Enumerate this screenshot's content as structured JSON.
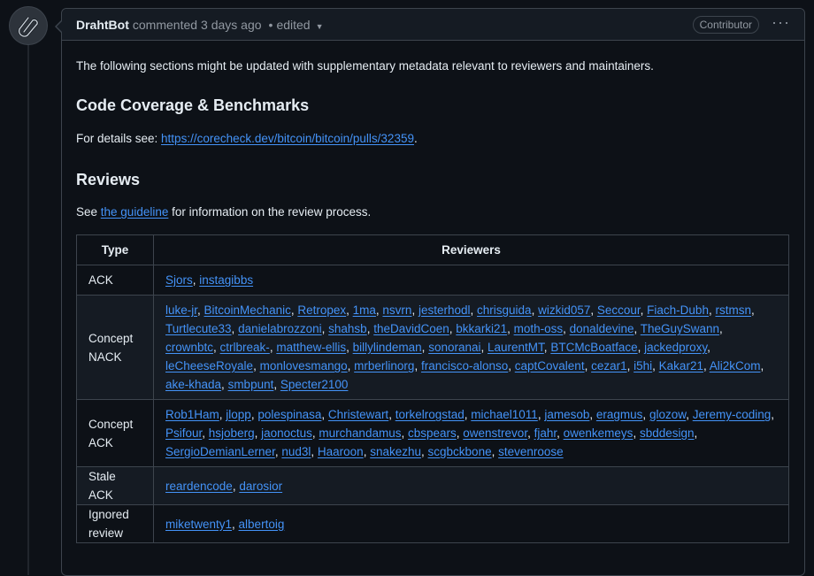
{
  "comment": {
    "author": "DrahtBot",
    "action": "commented",
    "time": "3 days ago",
    "separator": "•",
    "edited": "edited",
    "badge": "Contributor",
    "menu": "···"
  },
  "body": {
    "intro": "The following sections might be updated with supplementary metadata relevant to reviewers and maintainers.",
    "coverage_heading": "Code Coverage & Benchmarks",
    "details_prefix": "For details see: ",
    "details_link": "https://corecheck.dev/bitcoin/bitcoin/pulls/32359",
    "details_suffix": ".",
    "reviews_heading": "Reviews",
    "see_prefix": "See ",
    "guideline_link": "the guideline",
    "see_suffix": " for information on the review process."
  },
  "table": {
    "headers": [
      "Type",
      "Reviewers"
    ],
    "rows": [
      {
        "type": "ACK",
        "reviewers": [
          "Sjors",
          "instagibbs"
        ]
      },
      {
        "type": "Concept NACK",
        "reviewers": [
          "luke-jr",
          "BitcoinMechanic",
          "Retropex",
          "1ma",
          "nsvrn",
          "jesterhodl",
          "chrisguida",
          "wizkid057",
          "Seccour",
          "Fiach-Dubh",
          "rstmsn",
          "Turtlecute33",
          "danielabrozzoni",
          "shahsb",
          "theDavidCoen",
          "bkkarki21",
          "moth-oss",
          "donaldevine",
          "TheGuySwann",
          "crownbtc",
          "ctrlbreak-",
          "matthew-ellis",
          "billylindeman",
          "sonoranai",
          "LaurentMT",
          "BTCMcBoatface",
          "jackedproxy",
          "leCheeseRoyale",
          "monlovesmango",
          "mrberlinorg",
          "francisco-alonso",
          "captCovalent",
          "cezar1",
          "i5hi",
          "Kakar21",
          "Ali2kCom",
          "ake-khada",
          "smbpunt",
          "Specter2100"
        ]
      },
      {
        "type": "Concept ACK",
        "reviewers": [
          "Rob1Ham",
          "jlopp",
          "polespinasa",
          "Christewart",
          "torkelrogstad",
          "michael1011",
          "jamesob",
          "eragmus",
          "glozow",
          "Jeremy-coding",
          "Psifour",
          "hsjoberg",
          "jaonoctus",
          "murchandamus",
          "cbspears",
          "owenstrevor",
          "fjahr",
          "owenkemeys",
          "sbddesign",
          "SergioDemianLerner",
          "nud3l",
          "Haaroon",
          "snakezhu",
          "scgbckbone",
          "stevenroose"
        ]
      },
      {
        "type": "Stale ACK",
        "reviewers": [
          "reardencode",
          "darosior"
        ]
      },
      {
        "type": "Ignored review",
        "reviewers": [
          "miketwenty1",
          "albertoig"
        ]
      }
    ]
  }
}
